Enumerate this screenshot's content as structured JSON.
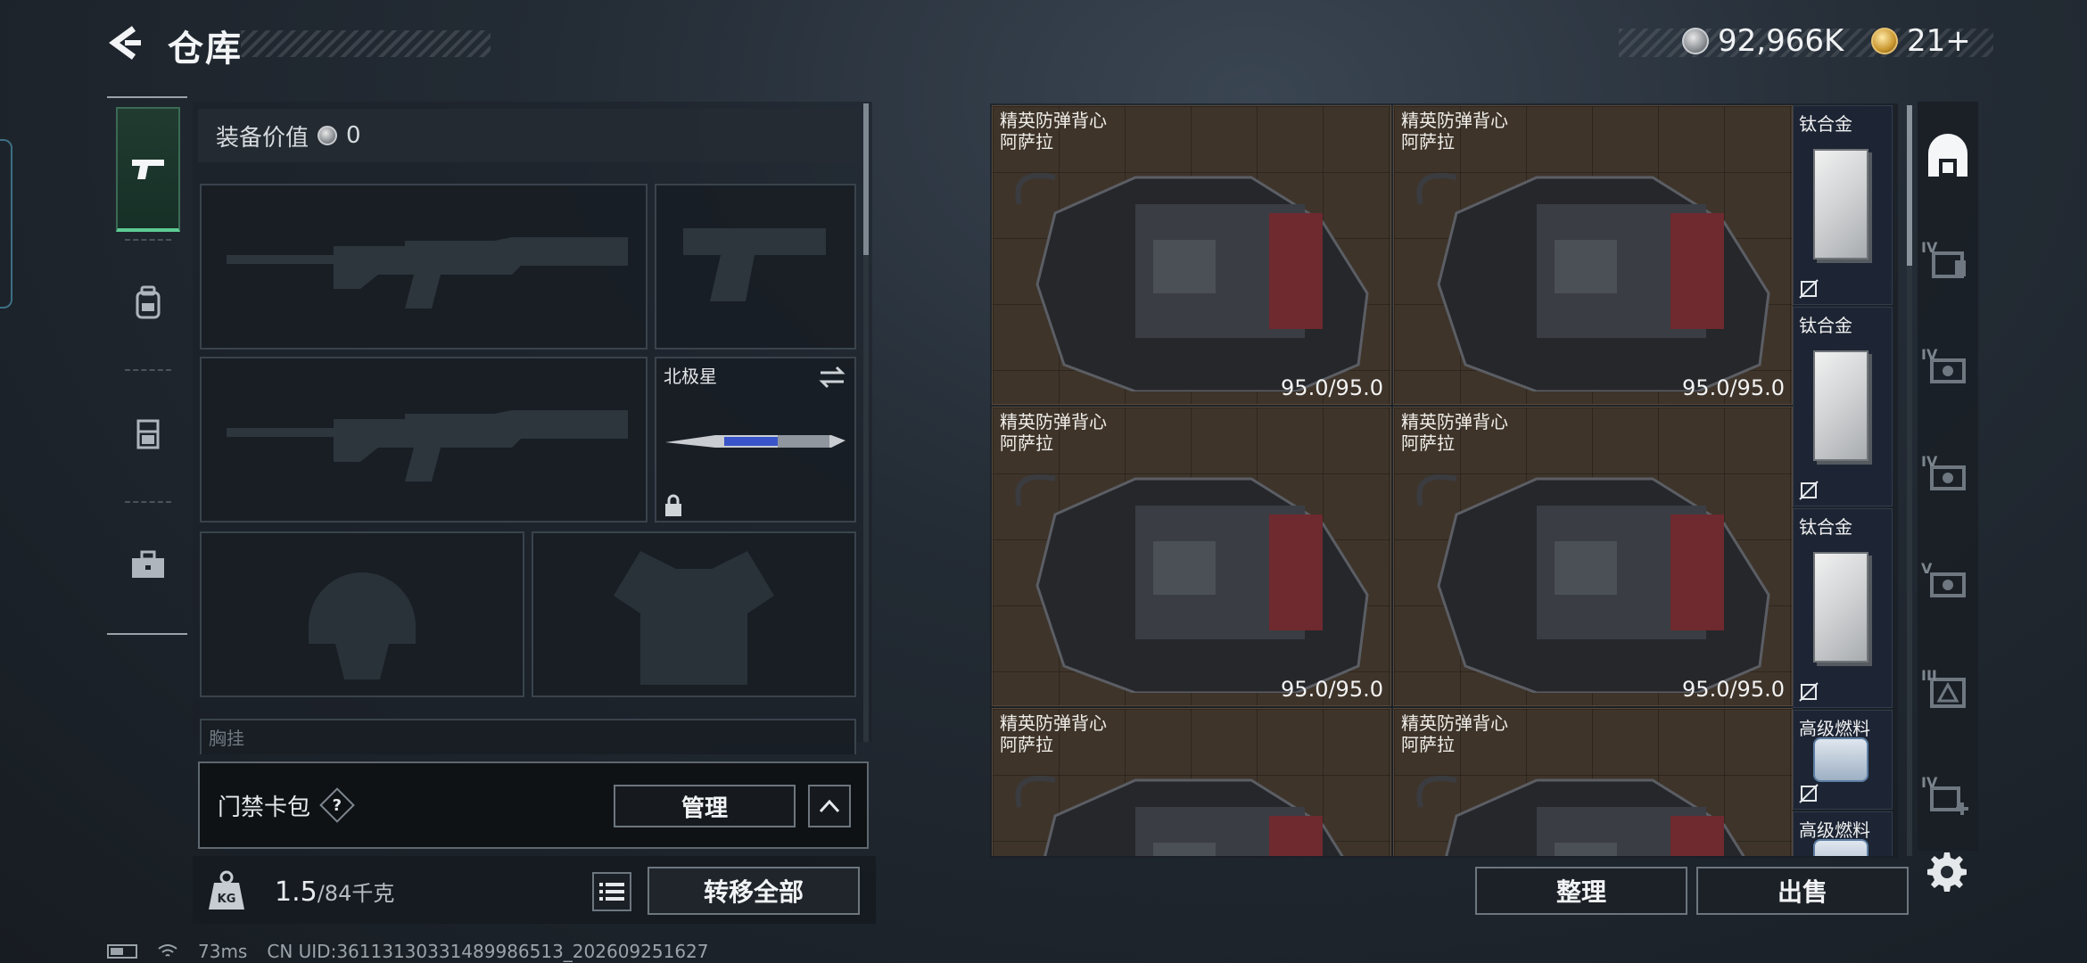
{
  "header": {
    "title": "仓库",
    "currency": [
      {
        "icon": "silver-coin-icon",
        "amount": "92,966K"
      },
      {
        "icon": "gold-coin-icon",
        "amount": "21+"
      }
    ]
  },
  "left_tabs": [
    "pistol-icon",
    "backpack-icon",
    "chest-rig-icon",
    "toolbox-icon"
  ],
  "equipment": {
    "value_label": "装备价值",
    "value": "0",
    "melee_slot_name": "北极星",
    "rig_label": "胸挂"
  },
  "access_card": {
    "label": "门禁卡包",
    "help": "?",
    "manage_label": "管理"
  },
  "inventory_bar": {
    "weight_current": "1.5",
    "weight_max": "/84千克",
    "transfer_all_label": "转移全部"
  },
  "storage": {
    "vests": [
      {
        "name": "精英防弹背心",
        "sub": "阿萨拉",
        "durability": "95.0/95.0"
      },
      {
        "name": "精英防弹背心",
        "sub": "阿萨拉",
        "durability": "95.0/95.0"
      },
      {
        "name": "精英防弹背心",
        "sub": "阿萨拉",
        "durability": "95.0/95.0"
      },
      {
        "name": "精英防弹背心",
        "sub": "阿萨拉",
        "durability": "95.0/95.0"
      },
      {
        "name": "精英防弹背心",
        "sub": "阿萨拉",
        "durability": ""
      },
      {
        "name": "精英防弹背心",
        "sub": "阿萨拉",
        "durability": ""
      }
    ],
    "small_items": [
      {
        "name": "钛合金"
      },
      {
        "name": "钛合金"
      },
      {
        "name": "钛合金"
      },
      {
        "name": "高级燃料"
      },
      {
        "name": "高级燃料"
      }
    ],
    "sort_label": "整理",
    "sell_label": "出售"
  },
  "right_tabs": [
    {
      "icon": "storage-icon",
      "level": ""
    },
    {
      "icon": "workbench-icon",
      "level": "IV"
    },
    {
      "icon": "tech-station-icon",
      "level": "IV"
    },
    {
      "icon": "gun-station-icon",
      "level": "IV"
    },
    {
      "icon": "armor-station-icon",
      "level": "V"
    },
    {
      "icon": "pharmacy-icon",
      "level": "III"
    },
    {
      "icon": "medical-station-icon",
      "level": "IV"
    }
  ],
  "status_bar": {
    "ping": "73ms",
    "uid": "CN UID:3611313033148998651​3_202609251627"
  },
  "colors": {
    "accent_green": "#5ccb93",
    "storage_bg": "#3e342a",
    "panel_bg": "#1b2128"
  }
}
